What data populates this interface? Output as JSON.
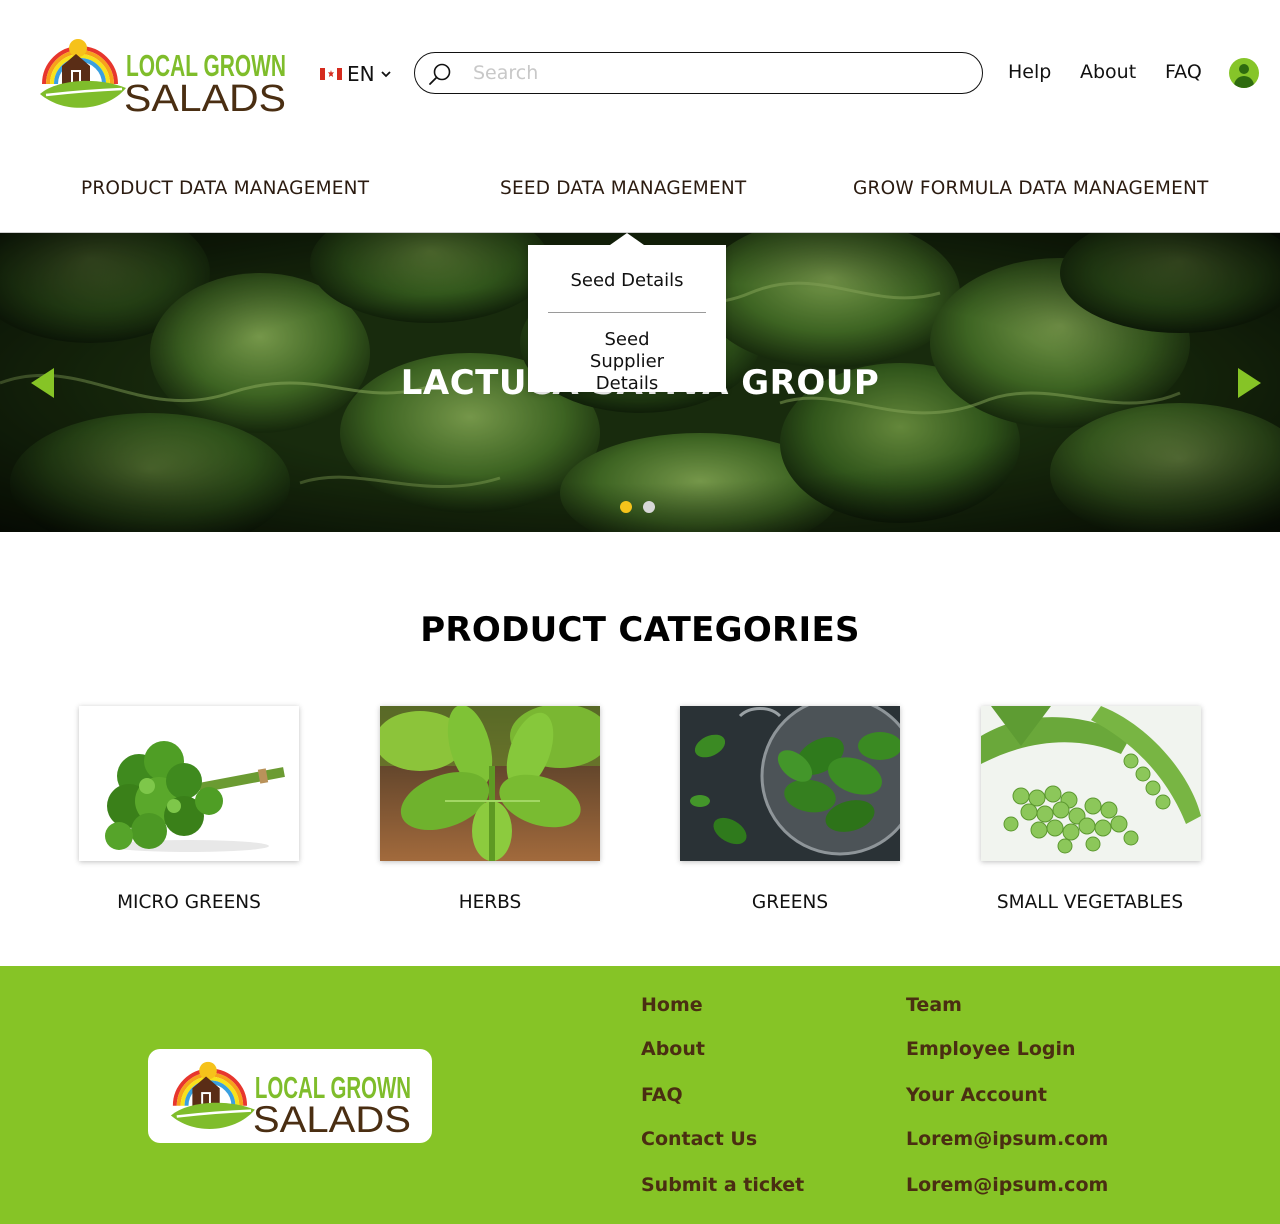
{
  "brand": {
    "logo_line1": "LOCAL GROWN",
    "logo_line2": "SALADS",
    "green": "#86c426",
    "brown": "#4a2e12"
  },
  "header": {
    "language": {
      "flag_icon": "canada-flag-icon",
      "label": "EN"
    },
    "search": {
      "placeholder": "Search",
      "value": ""
    },
    "links": {
      "help": "Help",
      "about": "About",
      "faq": "FAQ"
    },
    "account_icon": "user-avatar-icon"
  },
  "nav": {
    "items": [
      {
        "label": "PRODUCT DATA MANAGEMENT"
      },
      {
        "label": "SEED DATA MANAGEMENT"
      },
      {
        "label": "GROW FORMULA DATA MANAGEMENT"
      }
    ],
    "dropdown": {
      "items": [
        {
          "label": "Seed Details"
        },
        {
          "label": "Seed Supplier Details"
        }
      ]
    }
  },
  "hero": {
    "title": "LACTUCA SATIVA GROUP",
    "slide_count": 2,
    "active_slide": 1,
    "active_dot_color": "#f5c31b",
    "arrow_color": "#86c426"
  },
  "categories": {
    "title": "PRODUCT CATEGORIES",
    "items": [
      {
        "label": "MICRO GREENS",
        "image": "parsley-bunch-image"
      },
      {
        "label": "HERBS",
        "image": "basil-plant-image"
      },
      {
        "label": "GREENS",
        "image": "spinach-colander-image"
      },
      {
        "label": "SMALL VEGETABLES",
        "image": "green-peas-image"
      }
    ]
  },
  "footer": {
    "col1": [
      "Home",
      "About",
      "FAQ",
      "Contact Us",
      "Submit a ticket"
    ],
    "col2": [
      "Team",
      "Employee Login",
      "Your Account",
      "Lorem@ipsum.com",
      "Lorem@ipsum.com"
    ]
  }
}
